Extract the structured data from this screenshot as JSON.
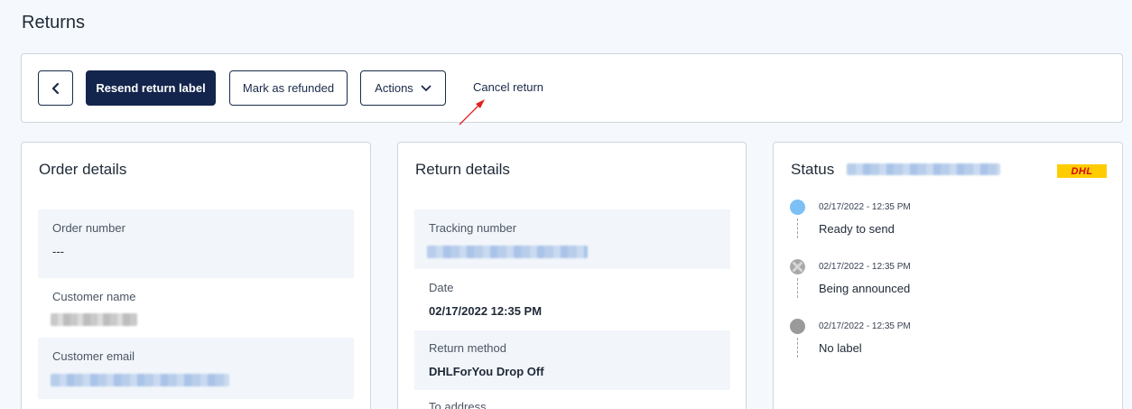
{
  "page": {
    "title": "Returns"
  },
  "toolbar": {
    "back_icon": "chevron-left-icon",
    "resend_label": "Resend return label",
    "refund_label": "Mark as refunded",
    "actions_label": "Actions",
    "actions_icon": "chevron-down-icon",
    "cancel_label": "Cancel return"
  },
  "order_details": {
    "title": "Order details",
    "order_number_label": "Order number",
    "order_number_value": "---",
    "customer_name_label": "Customer name",
    "customer_email_label": "Customer email"
  },
  "return_details": {
    "title": "Return details",
    "tracking_label": "Tracking number",
    "date_label": "Date",
    "date_value": "02/17/2022 12:35 PM",
    "method_label": "Return method",
    "method_value": "DHLForYou Drop Off",
    "address_label": "To address"
  },
  "status": {
    "title": "Status",
    "carrier_logo_text": "DHL",
    "events": [
      {
        "time": "02/17/2022 - 12:35 PM",
        "label": "Ready to send",
        "state": "active"
      },
      {
        "time": "02/17/2022 - 12:35 PM",
        "label": "Being announced",
        "state": "processing"
      },
      {
        "time": "02/17/2022 - 12:35 PM",
        "label": "No label",
        "state": "inactive"
      }
    ]
  },
  "colors": {
    "primary": "#13254c",
    "background": "#f5f8fc",
    "active_dot": "#7cc0f5",
    "inactive_dot": "#9a9a9a",
    "dhl_yellow": "#ffcc00",
    "dhl_red": "#d40511",
    "annotation_arrow": "#e02020"
  }
}
